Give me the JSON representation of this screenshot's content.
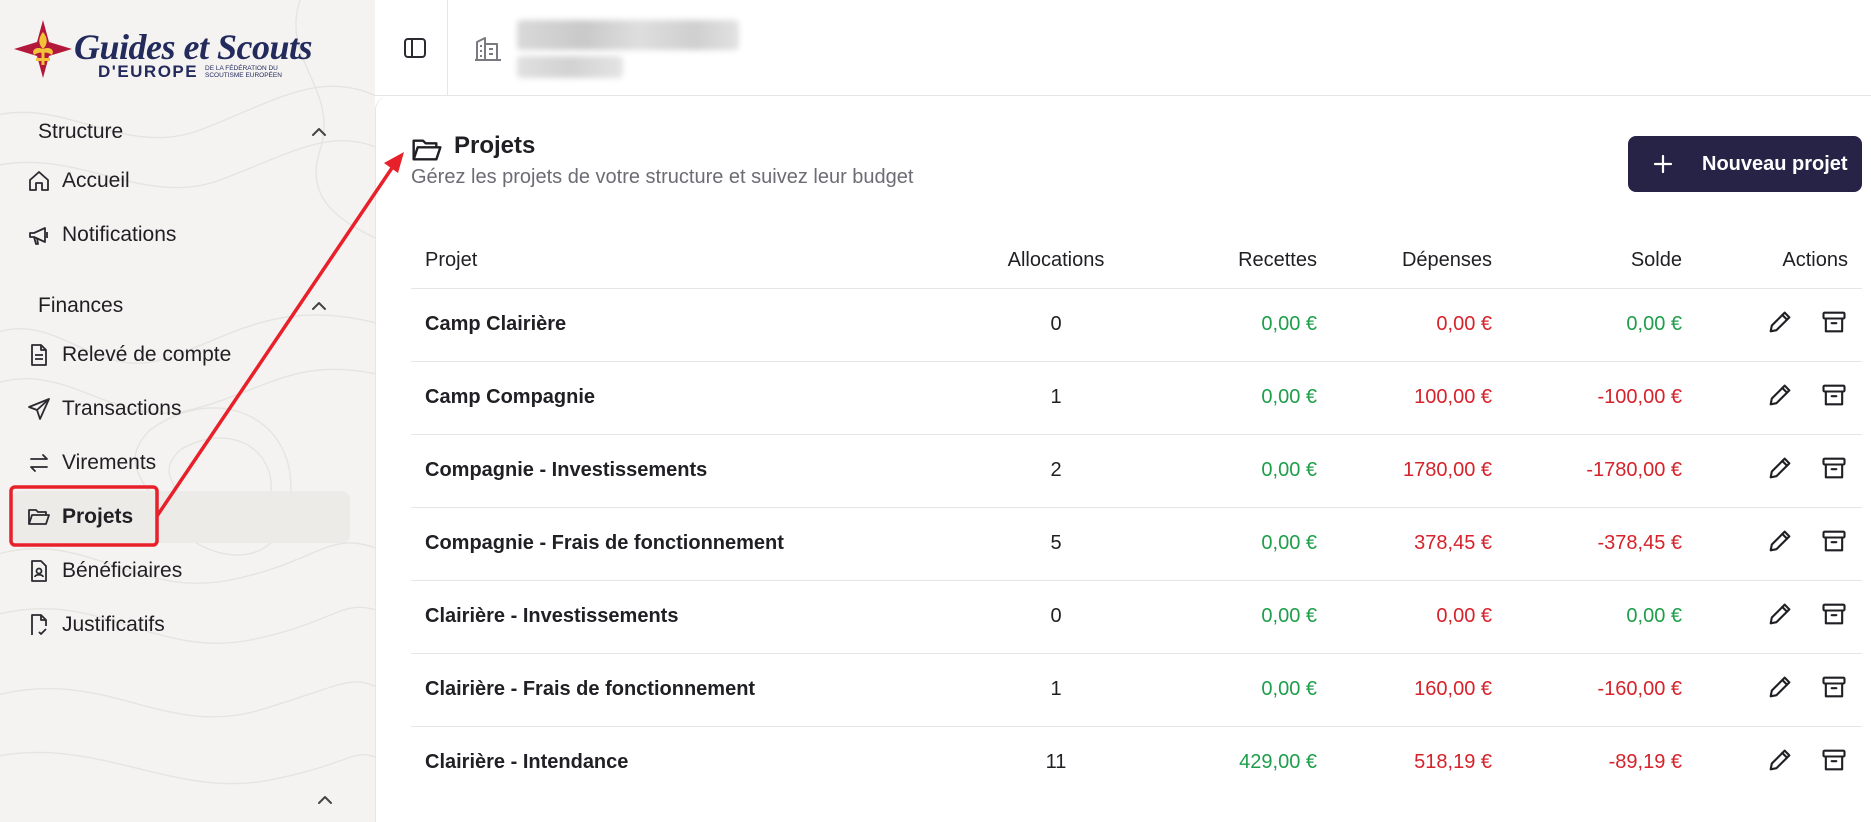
{
  "logo": {
    "line1": "Guides et Scouts",
    "line2": "D'EUROPE",
    "line3": "DE LA FÉDÉRATION DU SCOUTISME EUROPÉEN"
  },
  "sidebar": {
    "sections": [
      {
        "label": "Structure",
        "items": [
          {
            "label": "Accueil",
            "icon": "home-icon"
          },
          {
            "label": "Notifications",
            "icon": "megaphone-icon"
          }
        ]
      },
      {
        "label": "Finances",
        "items": [
          {
            "label": "Relevé de compte",
            "icon": "document-icon"
          },
          {
            "label": "Transactions",
            "icon": "send-icon"
          },
          {
            "label": "Virements",
            "icon": "transfer-icon"
          },
          {
            "label": "Projets",
            "icon": "folder-open-icon",
            "active": true
          },
          {
            "label": "Bénéficiaires",
            "icon": "beneficiary-icon"
          },
          {
            "label": "Justificatifs",
            "icon": "receipt-icon"
          }
        ]
      }
    ]
  },
  "page": {
    "title": "Projets",
    "subtitle": "Gérez les projets de votre structure et suivez leur budget",
    "new_button": "Nouveau projet"
  },
  "table": {
    "headers": [
      "Projet",
      "Allocations",
      "Recettes",
      "Dépenses",
      "Solde",
      "Actions"
    ],
    "rows": [
      {
        "name": "Camp Clairière",
        "allocations": "0",
        "recettes": "0,00 €",
        "depenses": "0,00 €",
        "solde": "0,00 €",
        "solde_sign": "pos"
      },
      {
        "name": "Camp Compagnie",
        "allocations": "1",
        "recettes": "0,00 €",
        "depenses": "100,00 €",
        "solde": "-100,00 €",
        "solde_sign": "neg"
      },
      {
        "name": "Compagnie - Investissements",
        "allocations": "2",
        "recettes": "0,00 €",
        "depenses": "1780,00 €",
        "solde": "-1780,00 €",
        "solde_sign": "neg"
      },
      {
        "name": "Compagnie - Frais de fonctionnement",
        "allocations": "5",
        "recettes": "0,00 €",
        "depenses": "378,45 €",
        "solde": "-378,45 €",
        "solde_sign": "neg"
      },
      {
        "name": "Clairière - Investissements",
        "allocations": "0",
        "recettes": "0,00 €",
        "depenses": "0,00 €",
        "solde": "0,00 €",
        "solde_sign": "pos"
      },
      {
        "name": "Clairière - Frais de fonctionnement",
        "allocations": "1",
        "recettes": "0,00 €",
        "depenses": "160,00 €",
        "solde": "-160,00 €",
        "solde_sign": "neg"
      },
      {
        "name": "Clairière - Intendance",
        "allocations": "11",
        "recettes": "429,00 €",
        "depenses": "518,19 €",
        "solde": "-89,19 €",
        "solde_sign": "neg"
      }
    ]
  },
  "colors": {
    "positive": "#1e9e4a",
    "negative": "#d6222a",
    "primary": "#272346",
    "annotation": "#e8202a"
  }
}
